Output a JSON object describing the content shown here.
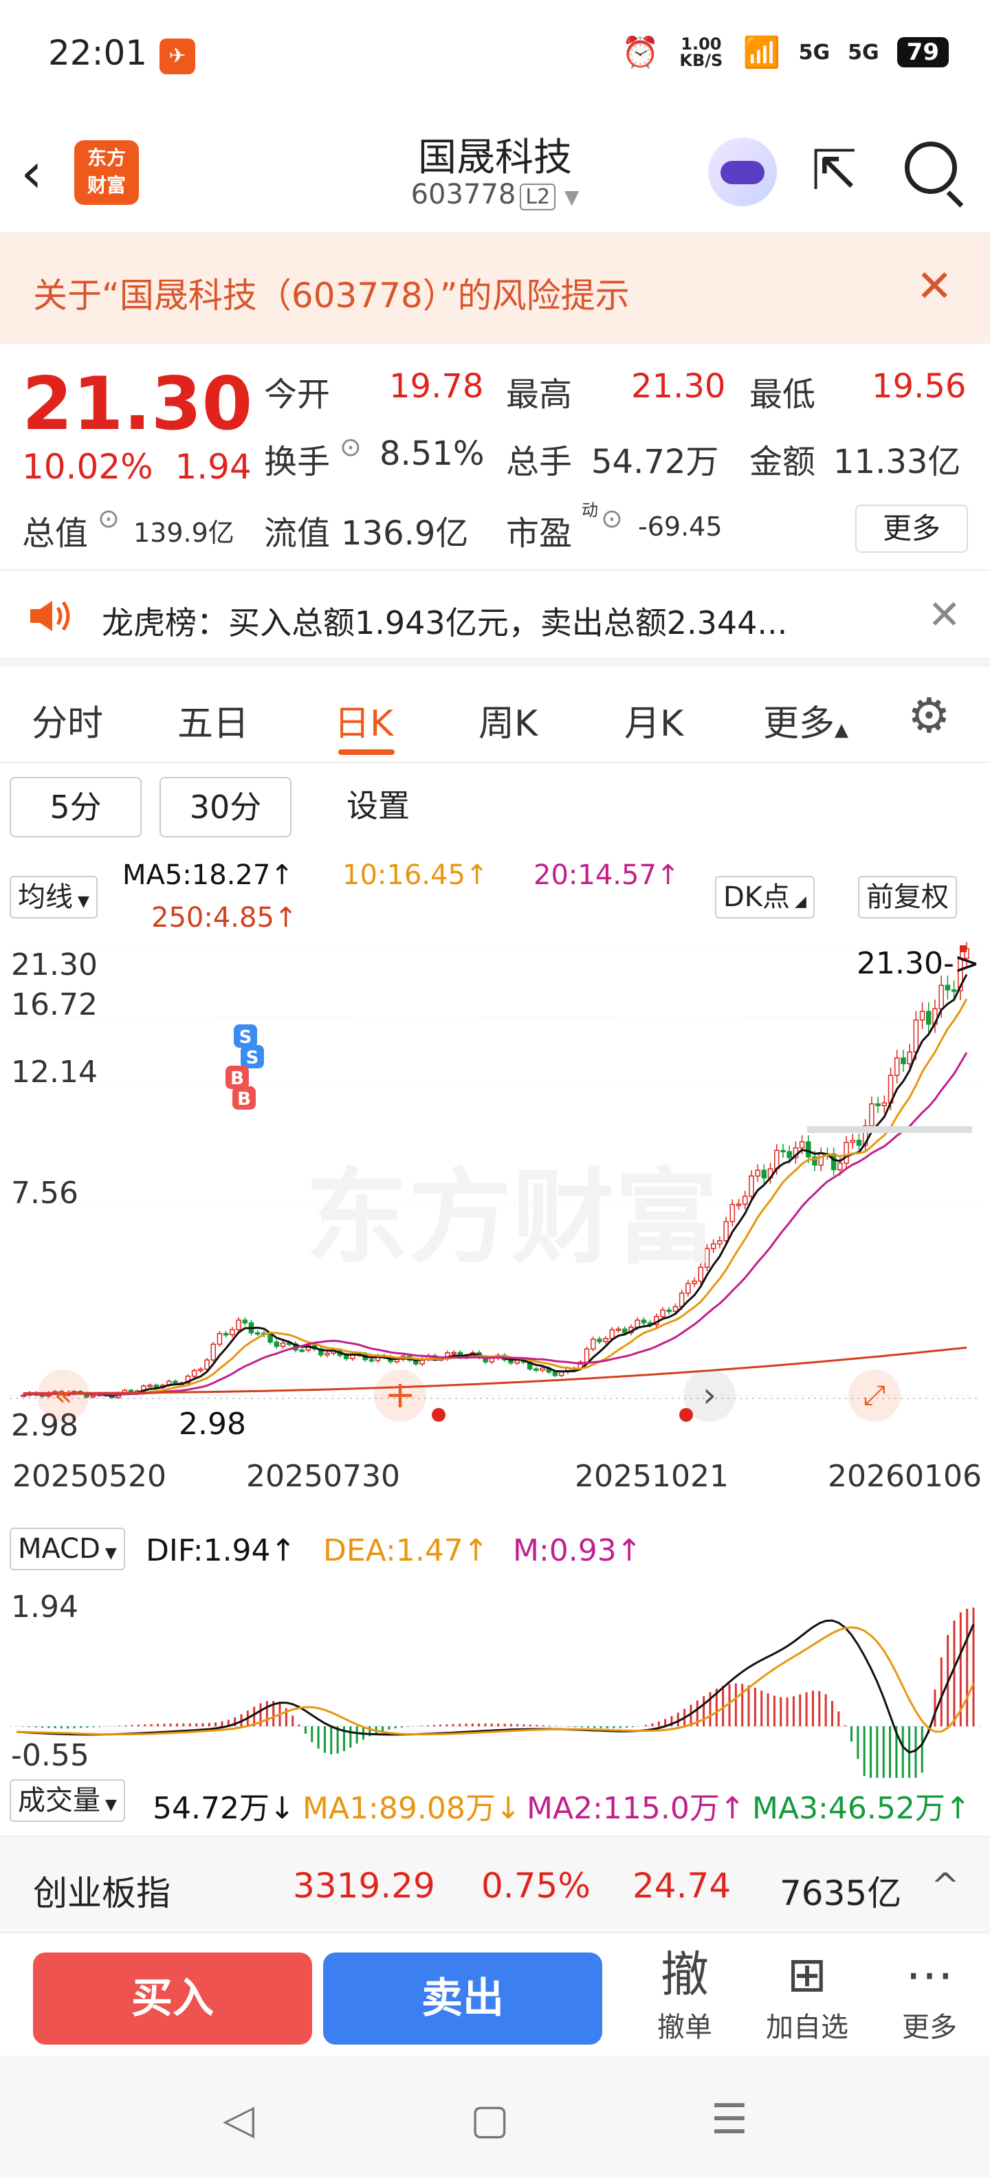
{
  "status_bar": {
    "time": "22:01",
    "speed": "1.00 KB/S",
    "signal1": "5G",
    "signal2": "5G",
    "battery": "79"
  },
  "nav": {
    "logo_line1": "东方",
    "logo_line2": "财富",
    "title": "国晟科技",
    "code": "603778",
    "level_badge": "L2"
  },
  "risk_banner": {
    "text": "关于“国晟科技（603778）”的风险提示"
  },
  "quote": {
    "price": "21.30",
    "change_pct": "10.02%",
    "change_amt": "1.94",
    "open_label": "今开",
    "open": "19.78",
    "high_label": "最高",
    "high": "21.30",
    "low_label": "最低",
    "low": "19.56",
    "turnover_label": "换手",
    "turnover": "8.51%",
    "volume_label": "总手",
    "volume": "54.72万",
    "amount_label": "金额",
    "amount": "11.33亿",
    "mcap_label": "总值",
    "mcap": "139.9亿",
    "float_label": "流值",
    "float_cap": "136.9亿",
    "pe_label": "市盈",
    "pe_sup": "动",
    "pe": "-69.45",
    "more": "更多"
  },
  "lhb": {
    "text": "龙虎榜：买入总额1.943亿元，卖出总额2.344..."
  },
  "kline_tabs": {
    "items": [
      "分时",
      "五日",
      "日K",
      "周K",
      "月K",
      "更多"
    ],
    "active": "日K"
  },
  "intervals": {
    "b5": "5分",
    "b30": "30分",
    "settings": "设置"
  },
  "ma_legend": {
    "selector": "均线",
    "ma5": "MA5:18.27↑",
    "ma10": "10:16.45↑",
    "ma20": "20:14.57↑",
    "ma250": "250:4.85↑",
    "dk": "DK点",
    "adjust": "前复权"
  },
  "colors": {
    "up": "#e0241d",
    "down": "#129b3a",
    "accent": "#ef5a1c",
    "ma5": "#111111",
    "ma10": "#e8960f",
    "ma20": "#c21f8c",
    "ma250": "#d2401f"
  },
  "chart_data": [
    {
      "type": "candlestick",
      "title": "",
      "y_tick_labels": [
        "21.30",
        "16.72",
        "12.14",
        "7.56",
        "2.98"
      ],
      "ylim": [
        2.98,
        21.3
      ],
      "x_tick_labels": [
        "20250520",
        "20250730",
        "20251021",
        "20260106"
      ],
      "max_annotation": "21.30->",
      "min_annotation": "2.98",
      "watermark": "东方财富",
      "signals": [
        "S",
        "S",
        "B",
        "B"
      ],
      "series": [
        {
          "name": "MA5",
          "value": 18.27
        },
        {
          "name": "MA10",
          "value": 16.45
        },
        {
          "name": "MA20",
          "value": 14.57
        },
        {
          "name": "MA250",
          "value": 4.85
        }
      ],
      "close_approx": [
        3.0,
        3.05,
        3.1,
        3.0,
        2.98,
        3.2,
        3.4,
        3.5,
        4.0,
        5.5,
        6.0,
        5.3,
        5.0,
        4.9,
        4.7,
        4.6,
        4.5,
        4.5,
        4.4,
        4.6,
        4.7,
        4.5,
        4.5,
        4.2,
        3.9,
        4.0,
        5.2,
        5.6,
        5.9,
        6.2,
        7.0,
        8.5,
        10.0,
        11.6,
        12.4,
        13.2,
        12.8,
        12.5,
        13.5,
        15.0,
        16.7,
        18.5,
        19.36,
        21.3
      ]
    },
    {
      "type": "macd",
      "title": "MACD",
      "dif": "DIF:1.94↑",
      "dea": "DEA:1.47↑",
      "m": "M:0.93↑",
      "y_tick_labels": [
        "1.94",
        "-0.55"
      ],
      "ylim": [
        -0.55,
        1.94
      ]
    }
  ],
  "volume_legend": {
    "selector": "成交量",
    "vol": "54.72万↓",
    "ma1": "MA1:89.08万↓",
    "ma2": "MA2:115.0万↑",
    "ma3": "MA3:46.52万↑"
  },
  "index_bar": {
    "name": "创业板指",
    "value": "3319.29",
    "pct": "0.75%",
    "chg": "24.74",
    "amount": "7635亿"
  },
  "actions": {
    "buy": "买入",
    "sell": "卖出",
    "cancel_icon": "撤",
    "cancel": "撤单",
    "add": "加自选",
    "more": "更多"
  }
}
